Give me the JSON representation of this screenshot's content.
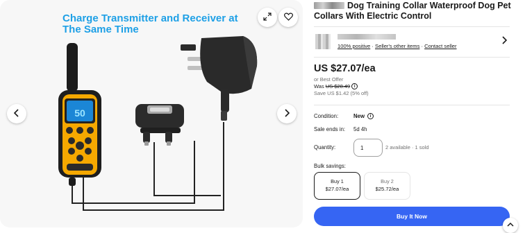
{
  "gallery": {
    "headline_line1": "Charge Transmitter and Receiver at",
    "headline_line2": "The Same Time",
    "remote_display": "50",
    "icons": {
      "expand": "expand-icon",
      "watch": "heart-icon",
      "prev": "chevron-left-icon",
      "next": "chevron-right-icon"
    }
  },
  "listing": {
    "title": "Dog Training Collar Waterproof Dog Pet Collars With Electric Control"
  },
  "seller": {
    "positive": "100% positive",
    "sep1": " · ",
    "other_items": "Seller's other items",
    "sep2": " · ",
    "contact": "Contact seller"
  },
  "pricing": {
    "price": "US $27.07/ea",
    "best_offer": "or Best Offer",
    "was_label": "Was",
    "was_price": "US $28.49",
    "save_text": "Save US $1.42 (5% off)"
  },
  "details": {
    "condition_label": "Condition:",
    "condition_value": "New",
    "sale_ends_label": "Sale ends in:",
    "sale_ends_value": "5d 4h",
    "quantity_label": "Quantity:",
    "quantity_value": "1",
    "availability": "2 available · 1 sold",
    "bulk_label": "Bulk savings:"
  },
  "bulk": [
    {
      "qty": "Buy 1",
      "price": "$27.07/ea"
    },
    {
      "qty": "Buy 2",
      "price": "$25.72/ea"
    }
  ],
  "actions": {
    "buy_now": "Buy It Now"
  },
  "colors": {
    "accent": "#3665f3",
    "headline": "#1ea0e6",
    "remote_yellow": "#f5a800"
  }
}
